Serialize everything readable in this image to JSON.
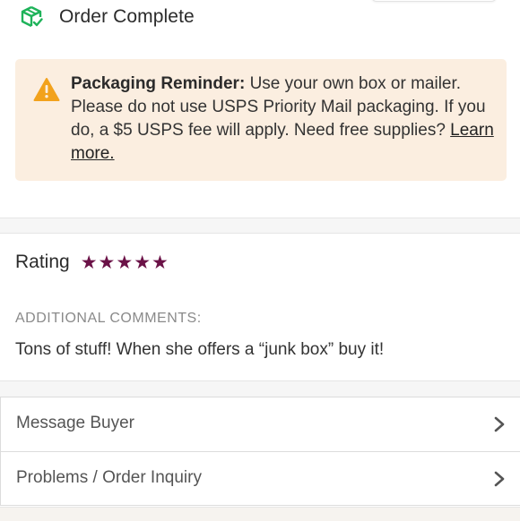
{
  "header": {
    "status_text": "Order Complete",
    "status_icon": "package-check-icon",
    "accent_color": "#1fb35a"
  },
  "reminder": {
    "icon": "warning-icon",
    "title": "Packaging Reminder:",
    "body": "Use your own box or mailer. Please do not use USPS Priority Mail packaging. If you do, a $5 USPS fee will apply. Need free supplies?",
    "link": "Learn more.",
    "background": "#fbeee0",
    "icon_color": "#f2a21c"
  },
  "rating": {
    "label": "Rating",
    "stars": 5,
    "max_stars": 5,
    "star_color": "#6b1247"
  },
  "comments": {
    "label": "ADDITIONAL COMMENTS:",
    "text": "Tons of stuff! When she offers a “junk box” buy it!"
  },
  "actions": [
    {
      "label": "Message Buyer"
    },
    {
      "label": "Problems / Order Inquiry"
    }
  ]
}
